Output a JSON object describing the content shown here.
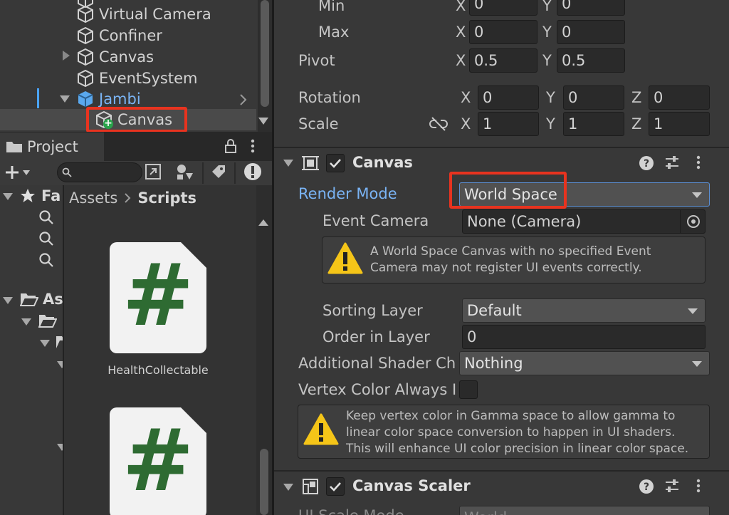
{
  "hierarchy": {
    "items": [
      {
        "label": "Virtual Camera"
      },
      {
        "label": "Confiner"
      },
      {
        "label": "Canvas"
      },
      {
        "label": "EventSystem"
      },
      {
        "label": "Jambi"
      },
      {
        "label": "Canvas"
      }
    ]
  },
  "project": {
    "tab_label": "Project",
    "breadcrumb_root": "Assets",
    "breadcrumb_current": "Scripts",
    "tree_favorites": "Fa",
    "tree_assets": "As",
    "assets": [
      {
        "name": "HealthCollectable",
        "glyph": "#"
      },
      {
        "name": "",
        "glyph": "#"
      }
    ]
  },
  "inspector": {
    "anchors": {
      "min_label": "Min",
      "min_x": "0",
      "min_y": "0",
      "max_label": "Max",
      "max_x": "0",
      "max_y": "0"
    },
    "pivot": {
      "label": "Pivot",
      "x": "0.5",
      "y": "0.5"
    },
    "rotation": {
      "label": "Rotation",
      "x": "0",
      "y": "0",
      "z": "0"
    },
    "scale": {
      "label": "Scale",
      "x": "1",
      "y": "1",
      "z": "1"
    },
    "axes": {
      "x": "X",
      "y": "Y",
      "z": "Z"
    },
    "canvas": {
      "title": "Canvas",
      "render_mode_label": "Render Mode",
      "render_mode_value": "World Space",
      "event_camera_label": "Event Camera",
      "event_camera_value": "None (Camera)",
      "warning_text": "A World Space Canvas with no specified Event Camera may not register UI events correctly.",
      "sorting_layer_label": "Sorting Layer",
      "sorting_layer_value": "Default",
      "order_in_layer_label": "Order in Layer",
      "order_in_layer_value": "0",
      "shader_channels_label": "Additional Shader Chá",
      "shader_channels_value": "Nothing",
      "vertex_color_label": "Vertex Color Always I",
      "vertex_help": "Keep vertex color in Gamma space to allow gamma to linear color space conversion to happen in UI shaders. This will enhance UI color precision in linear color space."
    },
    "canvas_scaler": {
      "title": "Canvas Scaler",
      "ui_scale_mode_label": "UI Scale Mode",
      "ui_scale_mode_value": "World"
    }
  },
  "colors": {
    "highlight": "#e8331f",
    "link_blue": "#7ab4f5",
    "script_green": "#2e6b32"
  }
}
